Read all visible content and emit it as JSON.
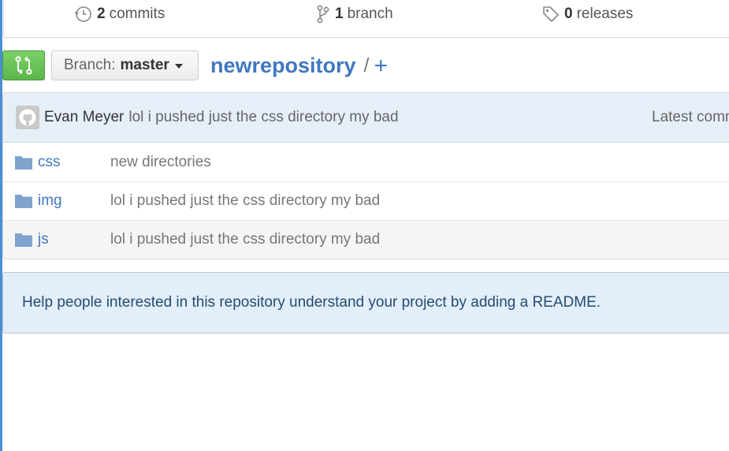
{
  "summary": {
    "commits": {
      "count": "2",
      "label": "commits",
      "icon": "history-icon"
    },
    "branches": {
      "count": "1",
      "label": "branch",
      "icon": "git-branch-icon"
    },
    "releases": {
      "count": "0",
      "label": "releases",
      "icon": "tag-icon"
    }
  },
  "toolbar": {
    "compare_icon": "compare-icon",
    "branch_prefix": "Branch:",
    "branch_name": "master",
    "repo_name": "newrepository",
    "separator": "/",
    "add_file": "+"
  },
  "latest_commit": {
    "author": "Evan Meyer",
    "message": "lol i pushed just the css directory my bad",
    "right_label": "Latest comm"
  },
  "files": [
    {
      "name": "css",
      "message": "new directories",
      "icon": "folder-icon"
    },
    {
      "name": "img",
      "message": "lol i pushed just the css directory my bad",
      "icon": "folder-icon"
    },
    {
      "name": "js",
      "message": "lol i pushed just the css directory my bad",
      "icon": "folder-icon"
    }
  ],
  "readme_prompt": "Help people interested in this repository understand your project by adding a README.",
  "colors": {
    "accent": "#4078c0",
    "primary_button": "#6cc644",
    "commit_bar": "#e6eff8"
  }
}
